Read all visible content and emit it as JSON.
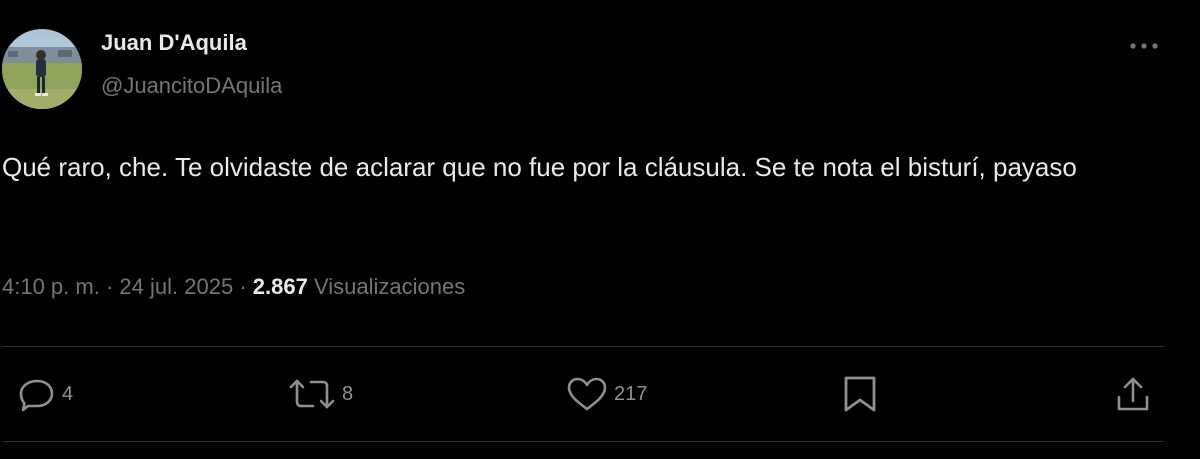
{
  "tweet": {
    "author": {
      "display_name": "Juan D'Aquila",
      "handle": "@JuancitoDAquila"
    },
    "text": "Qué raro, che. Te olvidaste de aclarar que no fue por la cláusula. Se te nota el bisturí, payaso",
    "time": "4:10 p. m.",
    "separator": "·",
    "date": "24 jul. 2025",
    "views_count": "2.867",
    "views_label": "Visualizaciones"
  },
  "actions": {
    "reply_count": "4",
    "retweet_count": "8",
    "like_count": "217"
  },
  "icons": {
    "more": "more-horizontal-icon",
    "reply": "reply-icon",
    "retweet": "retweet-icon",
    "like": "heart-icon",
    "bookmark": "bookmark-icon",
    "share": "share-icon"
  },
  "colors": {
    "background": "#000000",
    "text_primary": "#e7e9ea",
    "text_secondary": "#71767b",
    "divider": "#2f3336"
  }
}
